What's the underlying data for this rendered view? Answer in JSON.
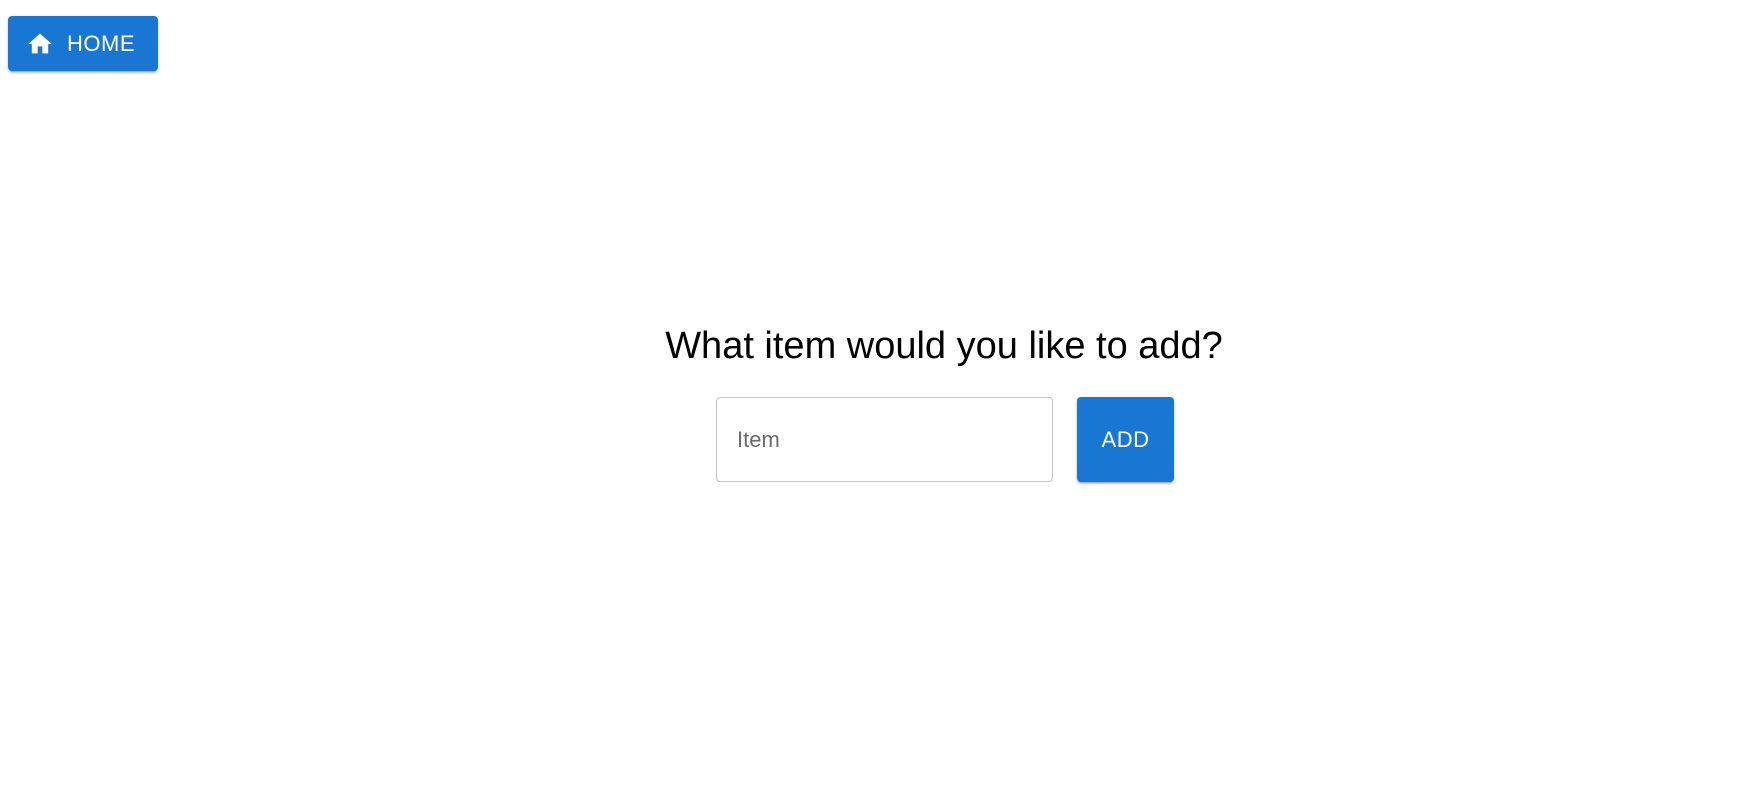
{
  "nav": {
    "home_label": "HOME",
    "home_icon": "home-icon"
  },
  "main": {
    "prompt": "What item would you like to add?",
    "item_input": {
      "placeholder": "Item",
      "value": ""
    },
    "add_label": "ADD"
  },
  "colors": {
    "primary": "#1976d2",
    "background": "#ffffff",
    "text": "#000000",
    "input_border": "#c4c4c4"
  }
}
